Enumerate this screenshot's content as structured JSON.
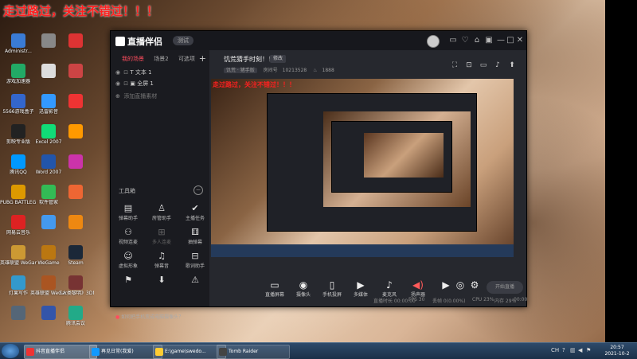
{
  "banner": "走过路过，关注不错过！！！",
  "desktop_icons": [
    {
      "label": "Administr...",
      "color": "#3a7bd5"
    },
    {
      "label": "",
      "color": "#888"
    },
    {
      "label": "",
      "color": "#d33"
    },
    {
      "label": "游戏加速器",
      "color": "#2a6"
    },
    {
      "label": "",
      "color": "#ddd"
    },
    {
      "label": "",
      "color": "#c44"
    },
    {
      "label": "5566游戏盒子",
      "color": "#36c"
    },
    {
      "label": "迅雷影音",
      "color": "#39f"
    },
    {
      "label": "",
      "color": "#e33"
    },
    {
      "label": "剪映专业版",
      "color": "#222"
    },
    {
      "label": "Excel 2007",
      "color": "#1d7"
    },
    {
      "label": "",
      "color": "#f90"
    },
    {
      "label": "腾讯QQ",
      "color": "#09f"
    },
    {
      "label": "Word 2007",
      "color": "#25a"
    },
    {
      "label": "",
      "color": "#c3a"
    },
    {
      "label": "PUBG BATTLEGR...",
      "color": "#d90"
    },
    {
      "label": "软件管家",
      "color": "#3b5"
    },
    {
      "label": "",
      "color": "#e63"
    },
    {
      "label": "网易云音乐",
      "color": "#d22"
    },
    {
      "label": "",
      "color": "#49e"
    },
    {
      "label": "",
      "color": "#e81"
    },
    {
      "label": "英雄联盟 WeGame版",
      "color": "#c93"
    },
    {
      "label": "WeGame",
      "color": "#b71"
    },
    {
      "label": "Steam",
      "color": "#1b2838"
    },
    {
      "label": "灯果写作",
      "color": "#39c"
    },
    {
      "label": "英雄联盟 WeGame版",
      "color": "#a52"
    },
    {
      "label": "《人类黎明》3DM",
      "color": "#733"
    },
    {
      "label": "",
      "color": "#567"
    },
    {
      "label": "",
      "color": "#35a"
    },
    {
      "label": "腾讯会议",
      "color": "#2a8"
    }
  ],
  "app": {
    "logo": "直播伴侣",
    "version_badge": "测试",
    "title_icons": [
      "▭",
      "♡",
      "⌂",
      "▣",
      "—",
      "□",
      "✕"
    ],
    "left_tabs": [
      {
        "label": "我的场景",
        "active": true
      },
      {
        "label": "场景2",
        "active": false
      },
      {
        "label": "可选项",
        "active": false
      }
    ],
    "add_symbol": "+",
    "sources": [
      {
        "icon": "T",
        "label": "文本 1"
      },
      {
        "icon": "▣",
        "label": "全屏 1"
      },
      {
        "icon": "⊕",
        "label": "添加直播素材"
      }
    ],
    "toolbox_title": "工具箱",
    "toolbox_toggle": "−",
    "tools": [
      {
        "glyph": "▤",
        "label": "弹幕助手",
        "dim": false
      },
      {
        "glyph": "♙",
        "label": "房管助手",
        "dim": false
      },
      {
        "glyph": "✔",
        "label": "主播任务",
        "dim": false
      },
      {
        "glyph": "⚇",
        "label": "视频连麦",
        "dim": false
      },
      {
        "glyph": "⊞",
        "label": "多人连麦",
        "dim": true
      },
      {
        "glyph": "⚅",
        "label": "抽弹幕",
        "dim": false
      },
      {
        "glyph": "☺",
        "label": "虚拟形象",
        "dim": false
      },
      {
        "glyph": "♫",
        "label": "弹幕音",
        "dim": false
      },
      {
        "glyph": "⊟",
        "label": "歌词助手",
        "dim": false
      },
      {
        "glyph": "⚑",
        "label": "",
        "dim": false
      },
      {
        "glyph": "⬇",
        "label": "",
        "dim": false
      },
      {
        "glyph": "⚠",
        "label": "",
        "dim": false
      }
    ],
    "hint_prefix": "如何把手机变成电脑摄像头？",
    "room_title": "饥荒猜手时刻！！！",
    "edit_label": "修改",
    "meta": {
      "category": "饥荒 · 猪手版",
      "room_label": "房间号",
      "room_id": "10213528",
      "heat": "1888"
    },
    "top_right_icons": [
      "⛶",
      "⊡",
      "▭",
      "♪",
      "⬆"
    ],
    "preview_banner": "走过路过，关注不错过！！！",
    "bottom_buttons": [
      {
        "glyph": "▭",
        "label": "直播屏幕"
      },
      {
        "glyph": "◉",
        "label": "摄像头"
      },
      {
        "glyph": "▯",
        "label": "手机投屏"
      },
      {
        "glyph": "▶",
        "label": "多媒体"
      },
      {
        "glyph": "♪",
        "label": "麦克风"
      },
      {
        "glyph": "◀)",
        "label": "扬声器"
      }
    ],
    "bottom_extra_icons": [
      "▶",
      "◎",
      "⚙"
    ],
    "start_live": "开始直播",
    "status": [
      "直播时长 00:00:00",
      "FPS 30",
      "丢帧 0(0.00%)",
      "CPU 23%",
      "内存 29%",
      "00:00"
    ]
  },
  "taskbar": {
    "tasks": [
      {
        "label": "抖音直播伴侣",
        "color": "#e33",
        "active": true
      },
      {
        "label": "再见日常(我爱)",
        "color": "#19f",
        "active": false
      },
      {
        "label": "E:\\game\\swedo...",
        "color": "#fc3",
        "active": false
      },
      {
        "label": "Tomb Raider",
        "color": "#444",
        "active": false
      }
    ],
    "lang": "CH",
    "time": "20:57",
    "date": "2021-10-2"
  }
}
